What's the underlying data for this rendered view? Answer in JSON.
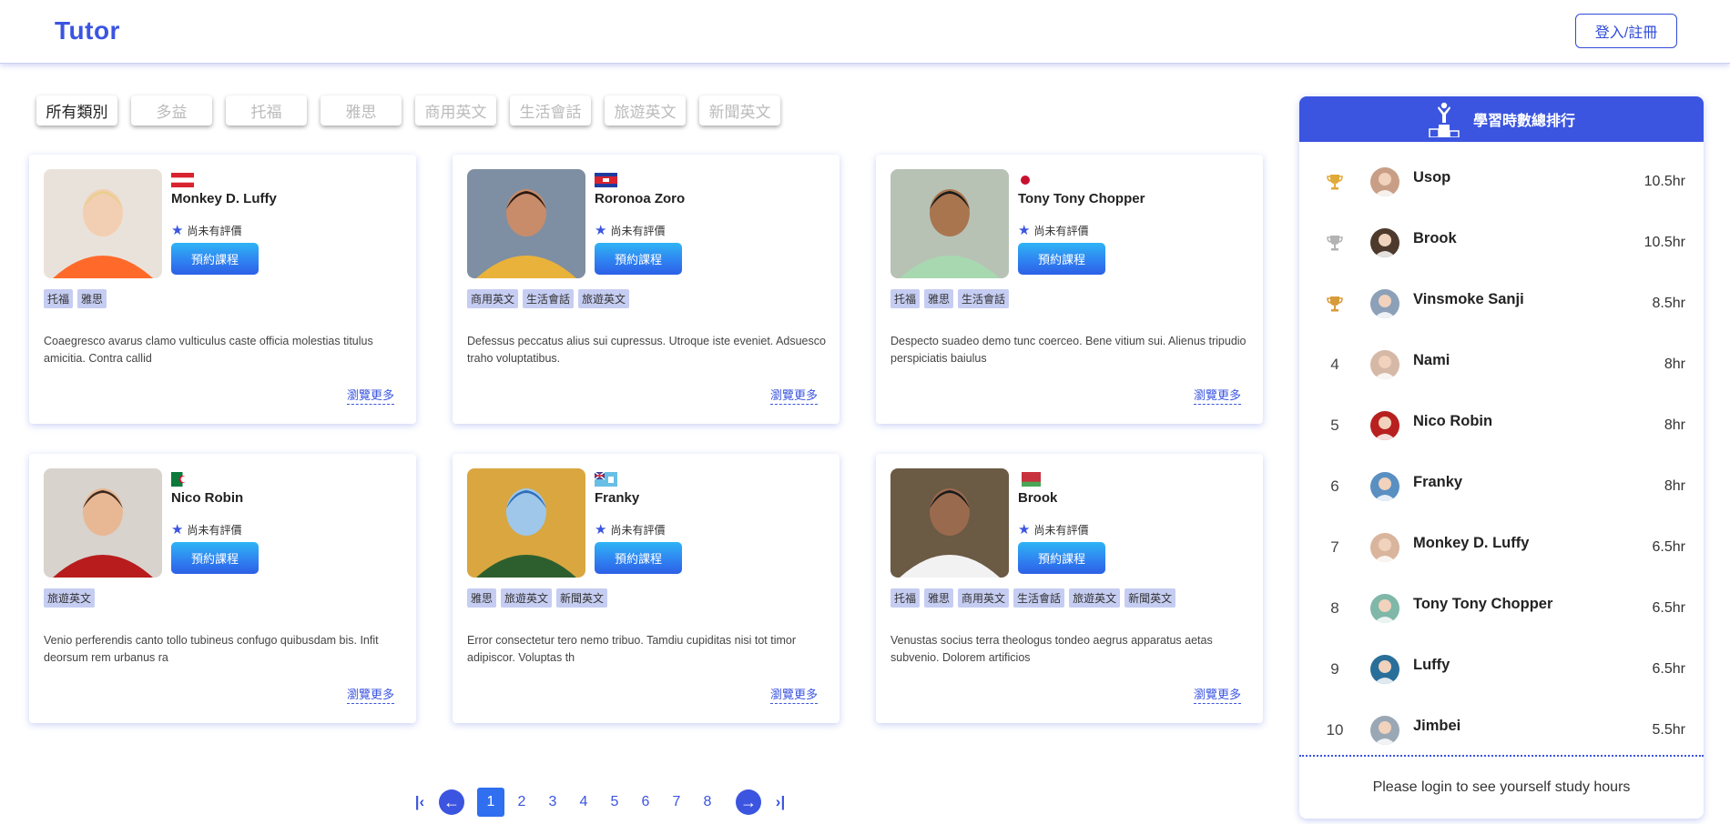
{
  "header": {
    "logo": "Tutor",
    "login_label": "登入/註冊"
  },
  "categories": [
    "所有類別",
    "多益",
    "托福",
    "雅思",
    "商用英文",
    "生活會話",
    "旅遊英文",
    "新聞英文"
  ],
  "teachers": [
    {
      "name": "Monkey D. Luffy",
      "rating": "尚未有評價",
      "book_label": "預約課程",
      "tags": [
        "托福",
        "雅思"
      ],
      "description": "Coaegresco avarus clamo vulticulus caste officia molestias titulus amicitia. Contra callid",
      "more_label": "瀏覽更多",
      "flag": "austria",
      "photo_color": "#e9e2da"
    },
    {
      "name": "Roronoa Zoro",
      "rating": "尚未有評價",
      "book_label": "預約課程",
      "tags": [
        "商用英文",
        "生活會話",
        "旅遊英文"
      ],
      "description": "Defessus peccatus alius sui cupressus. Utroque iste eveniet. Adsuesco traho voluptatibus.",
      "more_label": "瀏覽更多",
      "flag": "cambodia",
      "photo_color": "#7e8fa3"
    },
    {
      "name": "Tony Tony Chopper",
      "rating": "尚未有評價",
      "book_label": "預約課程",
      "tags": [
        "托福",
        "雅思",
        "生活會話"
      ],
      "description": "Despecto suadeo demo tunc coerceo. Bene vitium sui. Alienus tripudio perspiciatis baiulus",
      "more_label": "瀏覽更多",
      "flag": "japan",
      "photo_color": "#b7c2b5"
    },
    {
      "name": "Nico Robin",
      "rating": "尚未有評價",
      "book_label": "預約課程",
      "tags": [
        "旅遊英文"
      ],
      "description": "Venio perferendis canto tollo tubineus confugo quibusdam bis. Infit deorsum rem urbanus ra",
      "more_label": "瀏覽更多",
      "flag": "algeria",
      "photo_color": "#d8d3cd"
    },
    {
      "name": "Franky",
      "rating": "尚未有評價",
      "book_label": "預約課程",
      "tags": [
        "雅思",
        "旅遊英文",
        "新聞英文"
      ],
      "description": "Error consectetur tero nemo tribuo. Tamdiu cupiditas nisi tot timor adipiscor. Voluptas th",
      "more_label": "瀏覽更多",
      "flag": "fiji",
      "photo_color": "#d9a640"
    },
    {
      "name": "Brook",
      "rating": "尚未有評價",
      "book_label": "預約課程",
      "tags": [
        "托福",
        "雅思",
        "商用英文",
        "生活會話",
        "旅遊英文",
        "新聞英文"
      ],
      "description": "Venustas socius terra theologus tondeo aegrus apparatus aetas subvenio. Dolorem artificios",
      "more_label": "瀏覽更多",
      "flag": "belarus",
      "photo_color": "#6b5a44"
    }
  ],
  "pagination": {
    "pages": [
      "1",
      "2",
      "3",
      "4",
      "5",
      "6",
      "7",
      "8"
    ],
    "current": "1"
  },
  "ranking": {
    "title": "學習時數總排行",
    "rows": [
      {
        "rank": "1",
        "name": "Usop",
        "hours": "10.5hr",
        "trophy": "gold"
      },
      {
        "rank": "2",
        "name": "Brook",
        "hours": "10.5hr",
        "trophy": "silver"
      },
      {
        "rank": "3",
        "name": "Vinsmoke Sanji",
        "hours": "8.5hr",
        "trophy": "bronze"
      },
      {
        "rank": "4",
        "name": "Nami",
        "hours": "8hr"
      },
      {
        "rank": "5",
        "name": "Nico Robin",
        "hours": "8hr"
      },
      {
        "rank": "6",
        "name": "Franky",
        "hours": "8hr"
      },
      {
        "rank": "7",
        "name": "Monkey D. Luffy",
        "hours": "6.5hr"
      },
      {
        "rank": "8",
        "name": "Tony Tony Chopper",
        "hours": "6.5hr"
      },
      {
        "rank": "9",
        "name": "Luffy",
        "hours": "6.5hr"
      },
      {
        "rank": "10",
        "name": "Jimbei",
        "hours": "5.5hr"
      }
    ],
    "footer": "Please login to see yourself study hours"
  },
  "colors": {
    "primary": "#3b55e0",
    "tag_bg": "#c6cdf2",
    "gold": "#e0a93a",
    "silver": "#b3b3b3",
    "bronze": "#d89b3a"
  }
}
